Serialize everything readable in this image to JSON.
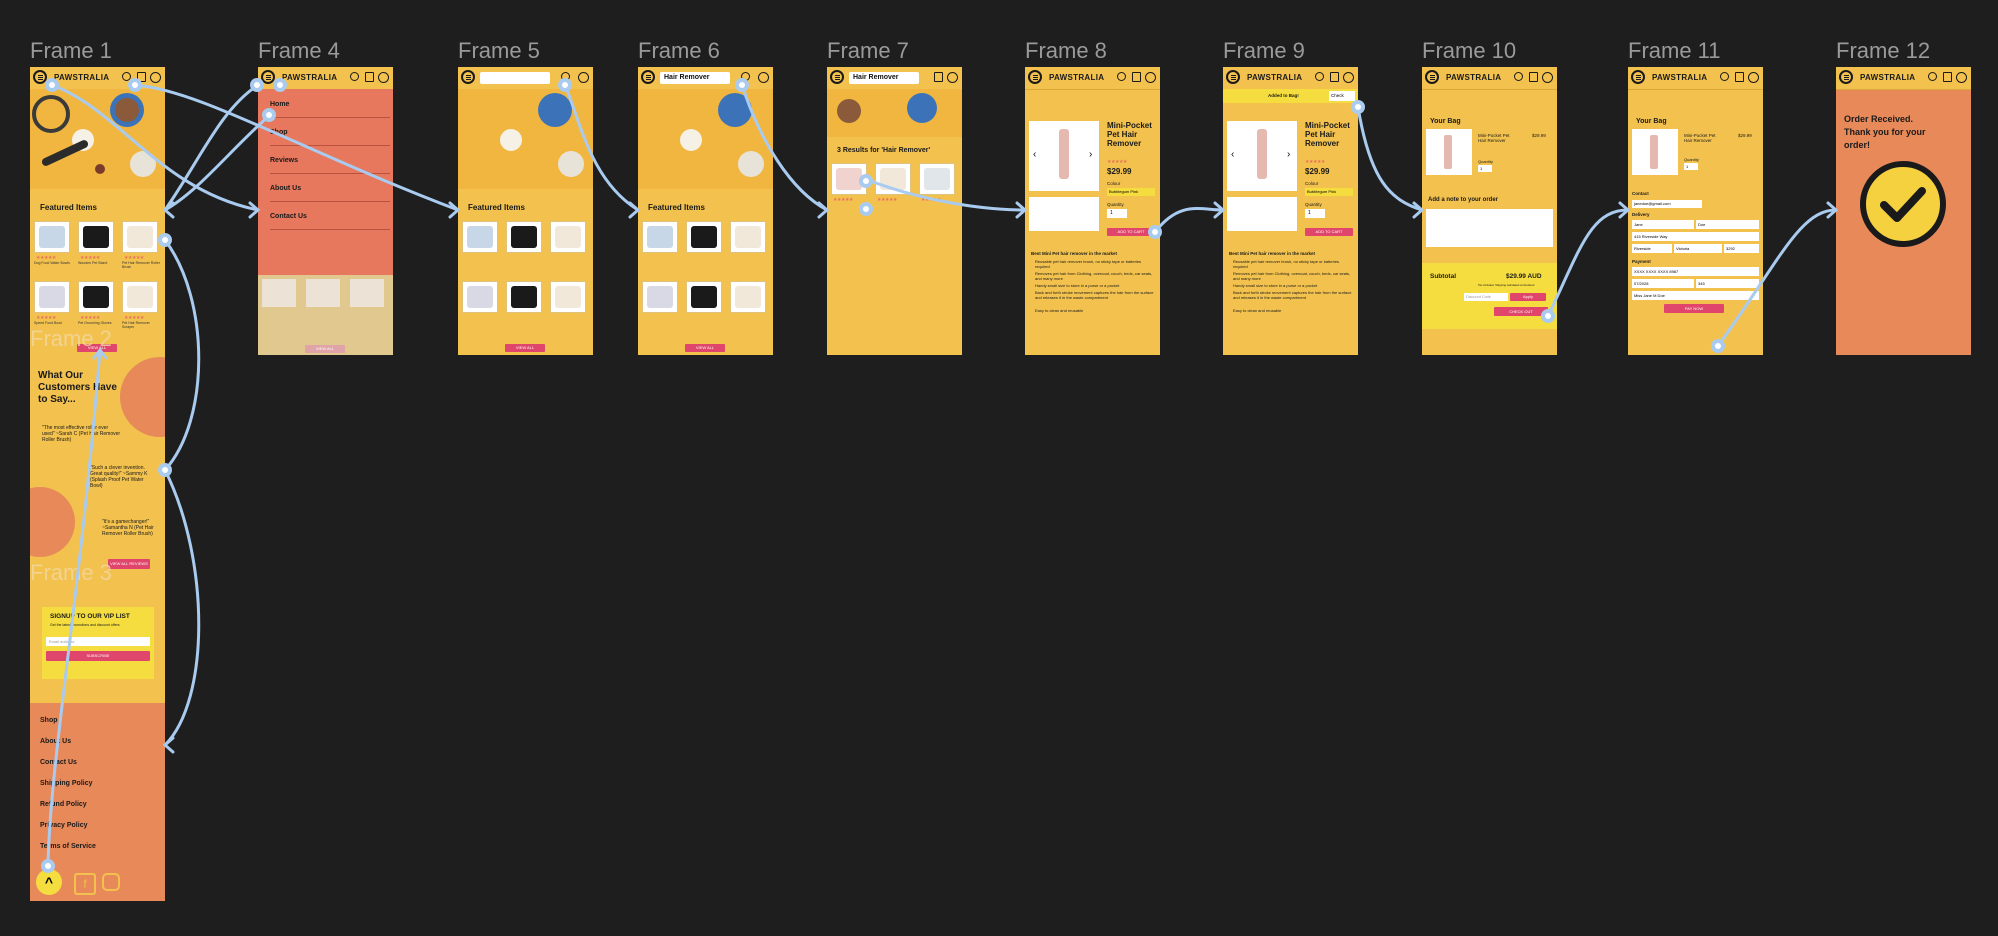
{
  "canvas": {
    "background": "#1e1e1e"
  },
  "frame_labels": {
    "f1": "Frame 1",
    "f4": "Frame 4",
    "f5": "Frame 5",
    "f6": "Frame 6",
    "f7": "Frame 7",
    "f8": "Frame 8",
    "f9": "Frame 9",
    "f10": "Frame 10",
    "f11": "Frame 11",
    "f12": "Frame 12",
    "f2": "Frame 2",
    "f3": "Frame 3"
  },
  "brand": "PAWSTRALIA",
  "colors": {
    "accent": "#e0456b",
    "yellow": "#f2c14e",
    "orange": "#e8895a",
    "link": "#a9cbef"
  },
  "home": {
    "featured_title": "Featured Items",
    "view_all": "VIEW ALL",
    "products": [
      "Dog Food Water Bowls",
      "Wooden Pet Stand",
      "Pet Hair Remover Roller Brush",
      "Speed Food Bowl",
      "Pet Grooming Gloves",
      "Pet Hair Remover Scraper"
    ],
    "testimonials_title": "What Our Customers Have to Say...",
    "t1": "\"The most effective roller ever used\" ~Sarah C (Pet Hair Remover Roller Brush)",
    "t2": "\"Such a clever invention. Great quality!\" ~Sammy K (Splash Proof Pet Water Bowl)",
    "t3": "\"It's a gamechanger!\" ~Samantha N (Pet Hair Remover Roller Brush)",
    "view_reviews": "VIEW ALL REVIEWS",
    "vip_title": "SIGNUP TO OUR VIP LIST",
    "vip_sub": "Get the latest promotions and discount offers",
    "vip_placeholder": "Email address",
    "subscribe": "SUBSCRIBE",
    "footer_links": [
      "Shop",
      "About Us",
      "Contact Us",
      "Shipping Policy",
      "Refund Policy",
      "Privacy Policy",
      "Terms of Service"
    ]
  },
  "menu": {
    "items": [
      "Home",
      "Shop",
      "Reviews",
      "About Us",
      "Contact Us"
    ]
  },
  "search": {
    "query": "Hair Remover",
    "results_title": "3 Results for 'Hair Remover'"
  },
  "product": {
    "name": "Mini-Pocket Pet Hair Remover",
    "price": "$29.99",
    "colour_label": "Colour",
    "colour_value": "Bubblegum Pink",
    "quantity_label": "Quantity",
    "quantity": "1",
    "add_to_cart": "ADD TO CART",
    "added_msg": "Added to Bag!",
    "checkout_small": "Check",
    "desc_title": "Best Mini Pet hair remover in the market",
    "bullets": [
      "Reusable pet hair remover brush, no sticky tape or batteries required",
      "Removes pet hair from Clothing, overcoat, couch, beds, car seats, and many more",
      "Handy small size to store in a purse or a pocket",
      "Back and forth stroke movement captures the hair from the surface and releases it in the waste compartment",
      "Easy to clean and reusable"
    ]
  },
  "bag": {
    "title": "Your Bag",
    "item_name": "Mini-Pocket Pet Hair Remover",
    "item_price": "$29.99",
    "qty_label": "Quantity",
    "qty": "1",
    "note_label": "Add a note to your order",
    "subtotal_label": "Subtotal",
    "subtotal": "$29.99 AUD",
    "shipping_note": "Tax included. Shipping calculated at checkout",
    "discount_placeholder": "Discount Code",
    "apply": "Apply",
    "checkout": "CHECK OUT"
  },
  "checkout": {
    "contact_label": "Contact",
    "email": "janedoe@gmail.com",
    "delivery_label": "Delivery",
    "first": "Jane",
    "last": "Doe",
    "address": "415 Riverside Way",
    "suburb": "Riverside",
    "state": "Victoria",
    "postcode": "3292",
    "payment_label": "Payment",
    "card": "XXXX XXXX XXXX 8987",
    "expiry": "07/2028",
    "cvv": "345",
    "card_name": "Miss Jane M Doe",
    "pay_now": "PAY NOW"
  },
  "order": {
    "message": "Order Received. Thank you for your order!"
  }
}
